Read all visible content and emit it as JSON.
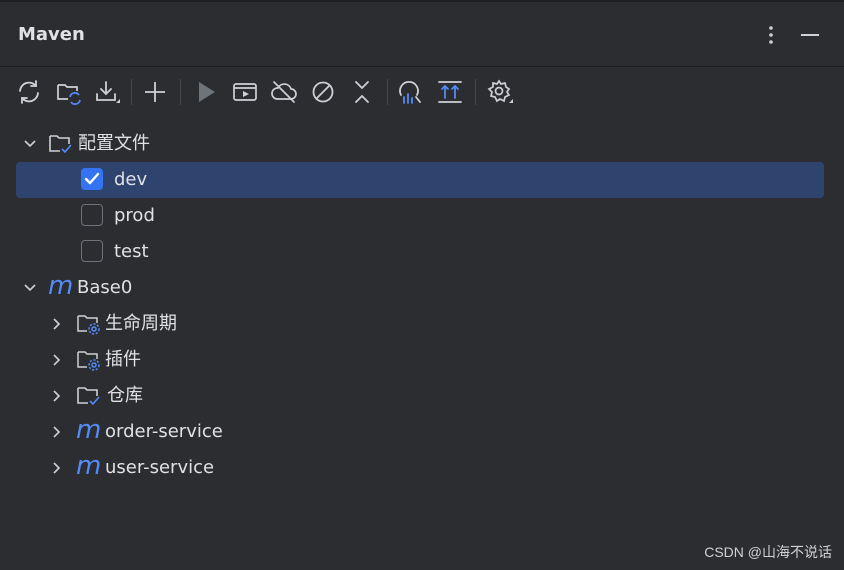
{
  "header": {
    "title": "Maven"
  },
  "tree": {
    "profiles_folder": "配置文件",
    "profiles": [
      {
        "label": "dev",
        "checked": true
      },
      {
        "label": "prod",
        "checked": false
      },
      {
        "label": "test",
        "checked": false
      }
    ],
    "project": "Base0",
    "project_children": [
      {
        "label": "生命周期",
        "icon": "folder-gear-icon"
      },
      {
        "label": "插件",
        "icon": "folder-gear-icon"
      },
      {
        "label": "仓库",
        "icon": "folder-check-icon"
      }
    ],
    "modules": [
      {
        "label": "order-service"
      },
      {
        "label": "user-service"
      }
    ]
  },
  "watermark": "CSDN @山海不说话",
  "colors": {
    "background": "#2b2d30",
    "selection": "#2e436e",
    "accent": "#3574f0",
    "maven_logo": "#548af7"
  }
}
